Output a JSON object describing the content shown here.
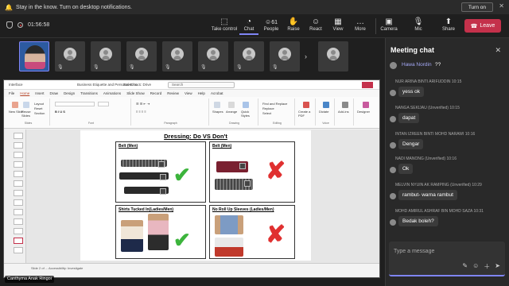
{
  "notification": {
    "message": "Stay in the know. Turn on desktop notifications.",
    "button": "Turn on",
    "close": "✕"
  },
  "meeting": {
    "timer": "01:56:58",
    "toolbar": [
      {
        "label": "Take control",
        "icon": "⬚"
      },
      {
        "label": "Chat",
        "icon": "💬"
      },
      {
        "label": "People",
        "icon": "👥",
        "count": "61"
      },
      {
        "label": "Raise",
        "icon": "✋"
      },
      {
        "label": "React",
        "icon": "☺"
      },
      {
        "label": "View",
        "icon": "▦"
      },
      {
        "label": "More",
        "icon": "…"
      },
      {
        "label": "Camera",
        "icon": "🎥"
      },
      {
        "label": "Mic",
        "icon": "🎙"
      },
      {
        "label": "Share",
        "icon": "⬆"
      }
    ],
    "leave_label": "Leave"
  },
  "participants": {
    "presenter_name": "Canthyma Anak Ringoi"
  },
  "ppt": {
    "file_title": "Business Etiquette and Personal Groo...",
    "saved": "Saved to S: Drive",
    "app": "Interface",
    "search": "Search",
    "tabs": [
      "File",
      "Home",
      "Insert",
      "Draw",
      "Design",
      "Transitions",
      "Animations",
      "Slide Show",
      "Record",
      "Review",
      "View",
      "Help",
      "Acrobat"
    ],
    "ribbon": {
      "new_slide": "New Slide",
      "reuse_slides": "Reuse Slides",
      "layout": "Layout",
      "reset": "Reset",
      "section": "Section",
      "slides_group": "Slides",
      "font_group": "Font",
      "paragraph_group": "Paragraph",
      "shapes": "Shapes",
      "arrange": "Arrange",
      "quick_styles": "Quick Styles",
      "drawing_group": "Drawing",
      "find": "Find and Replace",
      "replace": "Replace",
      "select": "Select",
      "editing_group": "Editing",
      "create_pdf": "Create a PDF",
      "dictate": "Dictate",
      "voice_group": "Voice",
      "addins": "Add-ins",
      "designer": "Designer"
    },
    "status": "Slide 2 of ...   Accessibility: Investigate"
  },
  "slide": {
    "title": "Dressing: Do VS Don't",
    "panels": [
      {
        "label": "Belt (Men)",
        "verdict": "do"
      },
      {
        "label": "Belt (Men)",
        "verdict": "dont"
      },
      {
        "label": "Shirts Tucked In(Ladies/Men)",
        "verdict": "do"
      },
      {
        "label": "No Roll Up Sleeves (Ladies/Men)",
        "verdict": "dont"
      }
    ],
    "check_glyph": "✔",
    "cross_glyph": "✘"
  },
  "chat": {
    "title": "Meeting chat",
    "first": {
      "name": "Hawa Nordin",
      "text": "??"
    },
    "messages": [
      {
        "sender": "NUR ARINA BINTI ARIFUDDIN",
        "time": "10:15",
        "text": "yess ok"
      },
      {
        "sender": "NANGA SEKIJAU (Unverified)",
        "time": "10:15",
        "text": "dapat"
      },
      {
        "sender": "INTAN IZREEN BINTI MOHD NARAWI",
        "time": "10:16",
        "text": "Dengar"
      },
      {
        "sender": "NADI MANONG (Unverified)",
        "time": "10:16",
        "text": "Ok"
      },
      {
        "sender": "MELVIN NYUIN AK RAMPING (Unverified)",
        "time": "10:29",
        "text": "rambut- warna rambut"
      },
      {
        "sender": "MOHD AMIRUL ASHRAF BIN MOHD SAZA",
        "time": "10:31",
        "text": "Bedak boleh?"
      }
    ],
    "compose_placeholder": "Type a message"
  },
  "colors": {
    "accent": "#7f85f5",
    "leave": "#c4314b",
    "check": "#3cb43c",
    "cross": "#e03030"
  }
}
